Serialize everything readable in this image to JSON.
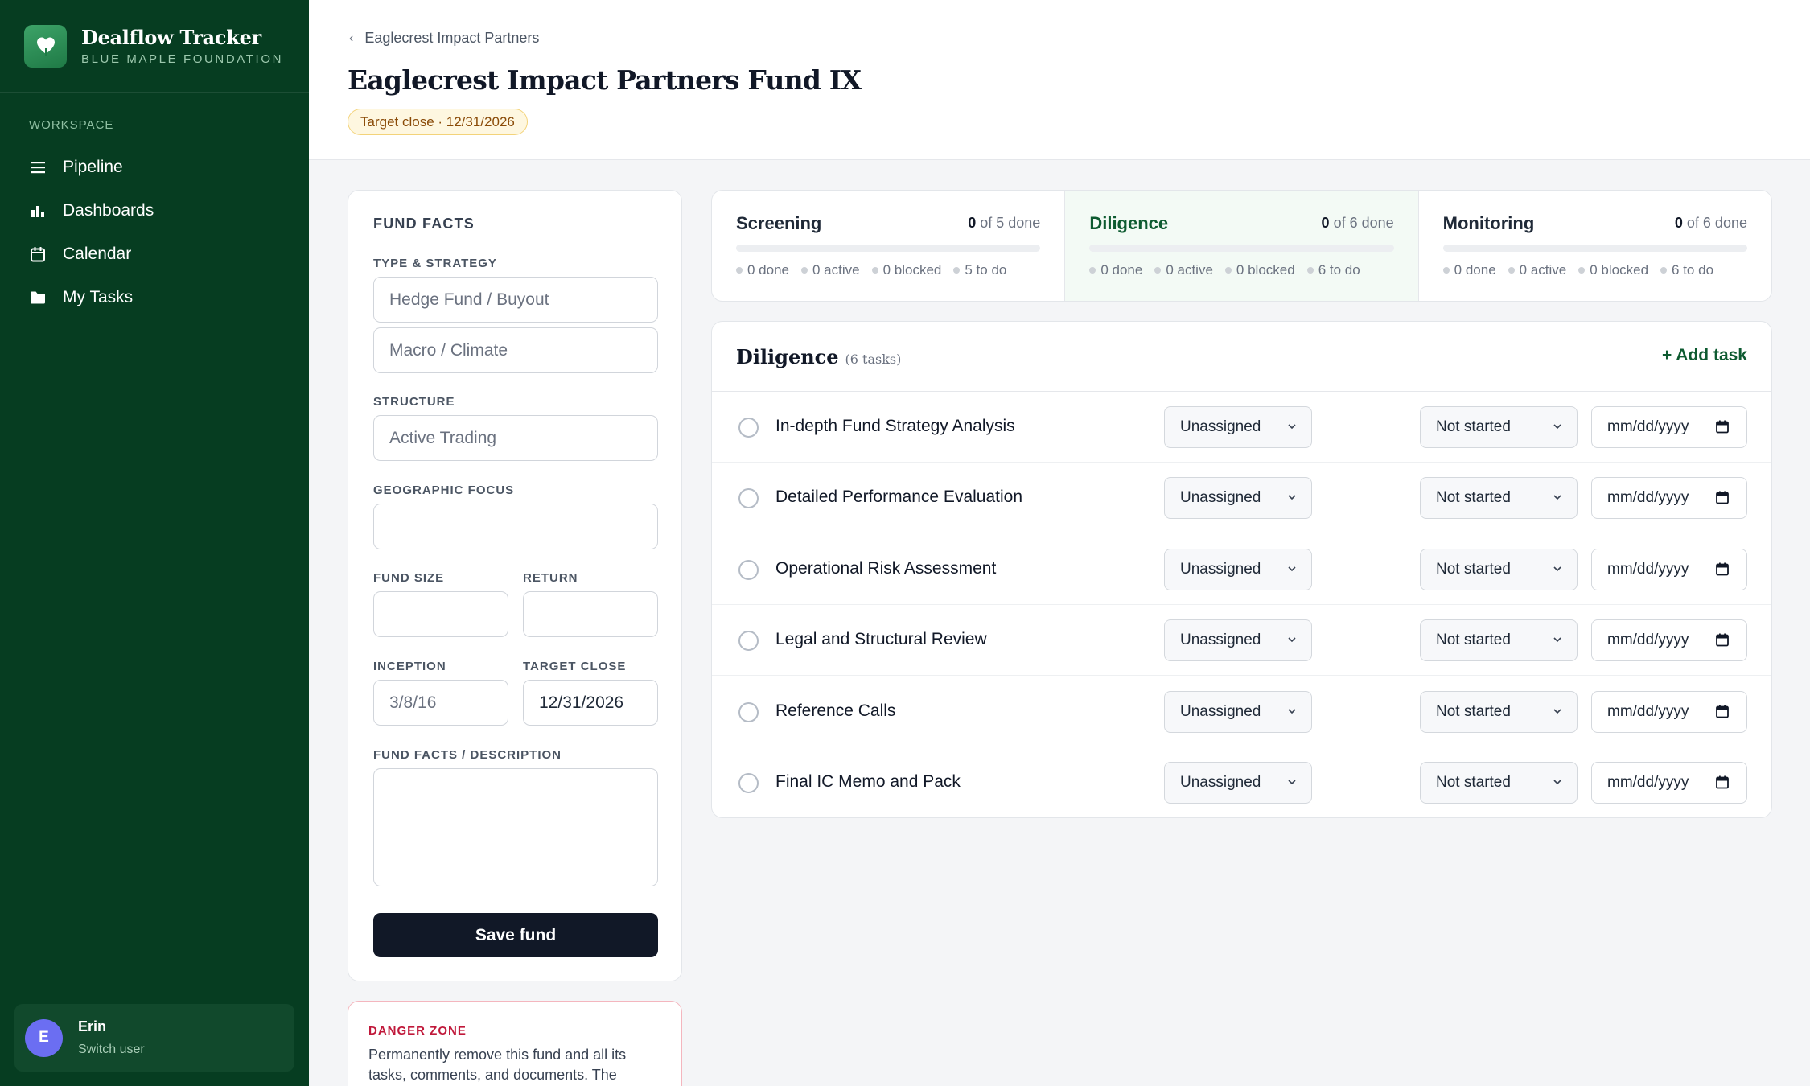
{
  "brand": {
    "title": "Dealflow Tracker",
    "subtitle": "BLUE MAPLE FOUNDATION",
    "logo_icon": "heart-leaf-icon"
  },
  "sidebar": {
    "section_label": "WORKSPACE",
    "items": [
      {
        "label": "Pipeline",
        "icon": "list-icon"
      },
      {
        "label": "Dashboards",
        "icon": "bar-chart-icon"
      },
      {
        "label": "Calendar",
        "icon": "calendar-icon"
      },
      {
        "label": "My Tasks",
        "icon": "folder-icon"
      }
    ],
    "user": {
      "initial": "E",
      "name": "Erin",
      "action": "Switch user"
    }
  },
  "header": {
    "breadcrumb": "Eaglecrest Impact Partners",
    "title": "Eaglecrest Impact Partners Fund IX",
    "badge": "Target close · 12/31/2026"
  },
  "fund_facts": {
    "title": "FUND FACTS",
    "type_label": "TYPE & STRATEGY",
    "type_value": "Hedge Fund / Buyout",
    "strategy_value": "Macro / Climate",
    "structure_label": "STRUCTURE",
    "structure_value": "Active Trading",
    "geo_label": "GEOGRAPHIC FOCUS",
    "geo_value": "",
    "size_label": "FUND SIZE",
    "size_value": "",
    "return_label": "RETURN",
    "return_value": "",
    "inception_label": "INCEPTION",
    "inception_value": "3/8/16",
    "target_close_label": "TARGET CLOSE",
    "target_close_value": "12/31/2026",
    "description_label": "FUND FACTS / DESCRIPTION",
    "description_value": "",
    "save_label": "Save fund"
  },
  "danger_zone": {
    "title": "DANGER ZONE",
    "text": "Permanently remove this fund and all its tasks, comments, and documents. The"
  },
  "stages": [
    {
      "name": "Screening",
      "done_count": "0",
      "of_text": "of 5 done",
      "progress": 0,
      "stats": [
        "0 done",
        "0 active",
        "0 blocked",
        "5 to do"
      ],
      "active": false
    },
    {
      "name": "Diligence",
      "done_count": "0",
      "of_text": "of 6 done",
      "progress": 0,
      "stats": [
        "0 done",
        "0 active",
        "0 blocked",
        "6 to do"
      ],
      "active": true
    },
    {
      "name": "Monitoring",
      "done_count": "0",
      "of_text": "of 6 done",
      "progress": 0,
      "stats": [
        "0 done",
        "0 active",
        "0 blocked",
        "6 to do"
      ],
      "active": false
    }
  ],
  "tasks_panel": {
    "title": "Diligence",
    "count_text": "(6 tasks)",
    "add_label": "+ Add task",
    "tasks": [
      {
        "name": "In-depth Fund Strategy Analysis",
        "assignee": "Unassigned",
        "status": "Not started",
        "date": "mm/dd/yyyy"
      },
      {
        "name": "Detailed Performance Evaluation",
        "assignee": "Unassigned",
        "status": "Not started",
        "date": "mm/dd/yyyy"
      },
      {
        "name": "Operational Risk Assessment",
        "assignee": "Unassigned",
        "status": "Not started",
        "date": "mm/dd/yyyy"
      },
      {
        "name": "Legal and Structural Review",
        "assignee": "Unassigned",
        "status": "Not started",
        "date": "mm/dd/yyyy"
      },
      {
        "name": "Reference Calls",
        "assignee": "Unassigned",
        "status": "Not started",
        "date": "mm/dd/yyyy"
      },
      {
        "name": "Final IC Memo and Pack",
        "assignee": "Unassigned",
        "status": "Not started",
        "date": "mm/dd/yyyy"
      }
    ]
  },
  "colors": {
    "sidebar_bg": "#063d21",
    "accent": "#0d5a30",
    "badge_bg": "#fef7e0",
    "danger": "#c0183a",
    "primary_button": "#111827"
  }
}
